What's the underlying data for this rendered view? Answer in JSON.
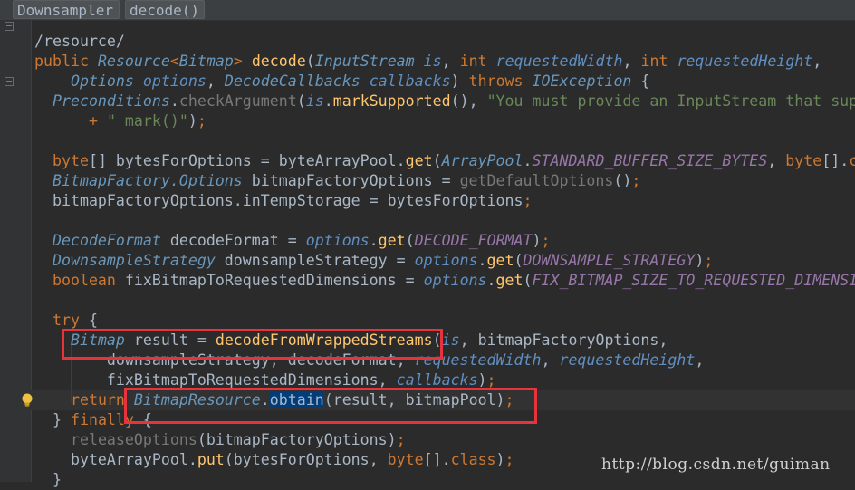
{
  "breadcrumb": {
    "items": [
      "Downsampler",
      "decode()"
    ]
  },
  "code": {
    "lines": [
      "/resource/",
      "public Resource<Bitmap> decode(InputStream is, int requestedWidth, int requestedHeight,",
      "    Options options, DecodeCallbacks callbacks) throws IOException {",
      "  Preconditions.checkArgument(is.markSupported(), \"You must provide an InputStream that sup",
      "      + \" mark()\");",
      "",
      "  byte[] bytesForOptions = byteArrayPool.get(ArrayPool.STANDARD_BUFFER_SIZE_BYTES, byte[].c",
      "  BitmapFactory.Options bitmapFactoryOptions = getDefaultOptions();",
      "  bitmapFactoryOptions.inTempStorage = bytesForOptions;",
      "",
      "  DecodeFormat decodeFormat = options.get(DECODE_FORMAT);",
      "  DownsampleStrategy downsampleStrategy = options.get(DOWNSAMPLE_STRATEGY);",
      "  boolean fixBitmapToRequestedDimensions = options.get(FIX_BITMAP_SIZE_TO_REQUESTED_DIMENSI",
      "",
      "  try {",
      "    Bitmap result = decodeFromWrappedStreams(is, bitmapFactoryOptions,",
      "        downsampleStrategy, decodeFormat, requestedWidth, requestedHeight,",
      "        fixBitmapToRequestedDimensions, callbacks);",
      "    return BitmapResource.obtain(result, bitmapPool);",
      "  } finally {",
      "    releaseOptions(bitmapFactoryOptions);",
      "    byteArrayPool.put(bytesForOptions, byte[].class);",
      "  }"
    ]
  },
  "watermark": "http://blog.csdn.net/guiman",
  "colors": {
    "background": "#2b2b2b",
    "keyword": "#cc7832",
    "type": "#6897bb",
    "method": "#ffc66d",
    "string": "#6a8759",
    "constant": "#9876aa",
    "highlight_box": "#e8323c"
  },
  "icons": [
    "fold-marker-icon",
    "lightbulb-icon"
  ]
}
